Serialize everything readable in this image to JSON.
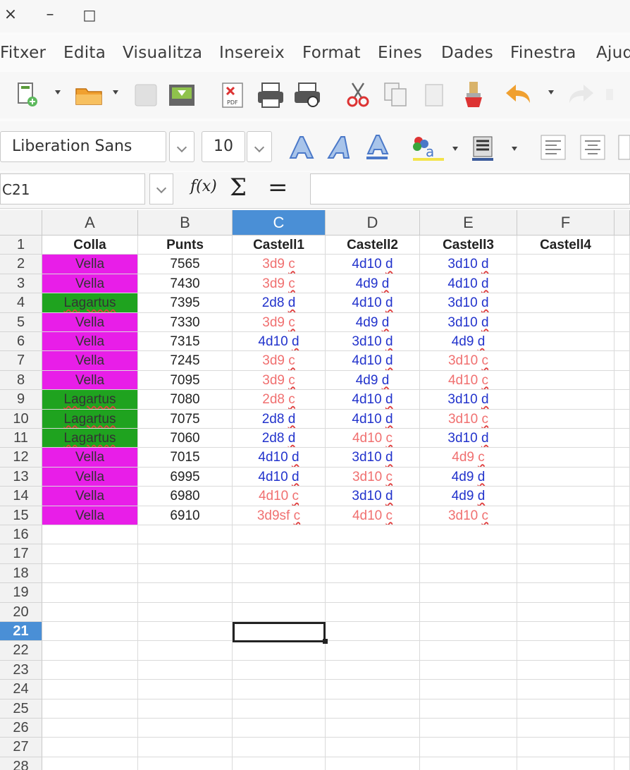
{
  "window": {
    "close_icon": "×",
    "minimize_icon": "–",
    "maximize_icon": "□"
  },
  "menu": [
    "Fitxer",
    "Edita",
    "Visualitza",
    "Insereix",
    "Format",
    "Eines",
    "Dades",
    "Finestra",
    "Ajuda"
  ],
  "font": {
    "name": "Liberation Sans",
    "size": "10"
  },
  "name_box": "C21",
  "formula_icons": {
    "fx": "f(x)",
    "sum": "Σ",
    "equals": "="
  },
  "columns": [
    "A",
    "B",
    "C",
    "D",
    "E",
    "F"
  ],
  "selected_column": "C",
  "selected_row": "21",
  "row_numbers": [
    "1",
    "2",
    "3",
    "4",
    "5",
    "6",
    "7",
    "8",
    "9",
    "10",
    "11",
    "12",
    "13",
    "14",
    "15",
    "16",
    "17",
    "18",
    "19",
    "20",
    "21",
    "22",
    "23",
    "24",
    "25",
    "26",
    "27",
    "28"
  ],
  "colors": {
    "vella": "#e81ee8",
    "lagartus": "#1fa31f",
    "selection": "#4a8fd6",
    "blue_text": "#2233cc",
    "salmon_text": "#f07070"
  },
  "sheet": {
    "headers": [
      "Colla",
      "Punts",
      "Castell1",
      "Castell2",
      "Castell3",
      "Castell4"
    ],
    "rows": [
      {
        "colla": "Vella",
        "punts": "7565",
        "c1": {
          "v": "3d9",
          "s": "c"
        },
        "c2": {
          "v": "4d10",
          "s": "d"
        },
        "c3": {
          "v": "3d10",
          "s": "d"
        }
      },
      {
        "colla": "Vella",
        "punts": "7430",
        "c1": {
          "v": "3d9",
          "s": "c"
        },
        "c2": {
          "v": "4d9",
          "s": "d"
        },
        "c3": {
          "v": "4d10",
          "s": "d"
        }
      },
      {
        "colla": "Lagartus",
        "punts": "7395",
        "c1": {
          "v": "2d8",
          "s": "d"
        },
        "c2": {
          "v": "4d10",
          "s": "d"
        },
        "c3": {
          "v": "3d10",
          "s": "d"
        }
      },
      {
        "colla": "Vella",
        "punts": "7330",
        "c1": {
          "v": "3d9",
          "s": "c"
        },
        "c2": {
          "v": "4d9",
          "s": "d"
        },
        "c3": {
          "v": "3d10",
          "s": "d"
        }
      },
      {
        "colla": "Vella",
        "punts": "7315",
        "c1": {
          "v": "4d10",
          "s": "d"
        },
        "c2": {
          "v": "3d10",
          "s": "d"
        },
        "c3": {
          "v": "4d9",
          "s": "d"
        }
      },
      {
        "colla": "Vella",
        "punts": "7245",
        "c1": {
          "v": "3d9",
          "s": "c"
        },
        "c2": {
          "v": "4d10",
          "s": "d"
        },
        "c3": {
          "v": "3d10",
          "s": "c"
        }
      },
      {
        "colla": "Vella",
        "punts": "7095",
        "c1": {
          "v": "3d9",
          "s": "c"
        },
        "c2": {
          "v": "4d9",
          "s": "d"
        },
        "c3": {
          "v": "4d10",
          "s": "c"
        }
      },
      {
        "colla": "Lagartus",
        "punts": "7080",
        "c1": {
          "v": "2d8",
          "s": "c"
        },
        "c2": {
          "v": "4d10",
          "s": "d"
        },
        "c3": {
          "v": "3d10",
          "s": "d"
        }
      },
      {
        "colla": "Lagartus",
        "punts": "7075",
        "c1": {
          "v": "2d8",
          "s": "d"
        },
        "c2": {
          "v": "4d10",
          "s": "d"
        },
        "c3": {
          "v": "3d10",
          "s": "c"
        }
      },
      {
        "colla": "Lagartus",
        "punts": "7060",
        "c1": {
          "v": "2d8",
          "s": "d"
        },
        "c2": {
          "v": "4d10",
          "s": "c"
        },
        "c3": {
          "v": "3d10",
          "s": "d"
        }
      },
      {
        "colla": "Vella",
        "punts": "7015",
        "c1": {
          "v": "4d10",
          "s": "d"
        },
        "c2": {
          "v": "3d10",
          "s": "d"
        },
        "c3": {
          "v": "4d9",
          "s": "c"
        }
      },
      {
        "colla": "Vella",
        "punts": "6995",
        "c1": {
          "v": "4d10",
          "s": "d"
        },
        "c2": {
          "v": "3d10",
          "s": "c"
        },
        "c3": {
          "v": "4d9",
          "s": "d"
        }
      },
      {
        "colla": "Vella",
        "punts": "6980",
        "c1": {
          "v": "4d10",
          "s": "c"
        },
        "c2": {
          "v": "3d10",
          "s": "d"
        },
        "c3": {
          "v": "4d9",
          "s": "d"
        }
      },
      {
        "colla": "Vella",
        "punts": "6910",
        "c1": {
          "v": "3d9sf",
          "s": "c"
        },
        "c2": {
          "v": "4d10",
          "s": "c"
        },
        "c3": {
          "v": "3d10",
          "s": "c"
        }
      }
    ]
  },
  "icons": [
    "new-document-icon",
    "open-folder-icon",
    "save-icon",
    "export-icon",
    "export-pdf-icon",
    "print-icon",
    "print-preview-icon",
    "cut-icon",
    "copy-icon",
    "paste-icon",
    "clone-format-icon",
    "undo-icon",
    "redo-icon",
    "font-style-a-icon",
    "italic-a-icon",
    "underline-a-icon",
    "highlight-icon",
    "background-color-icon",
    "align-left-icon",
    "align-center-icon"
  ]
}
